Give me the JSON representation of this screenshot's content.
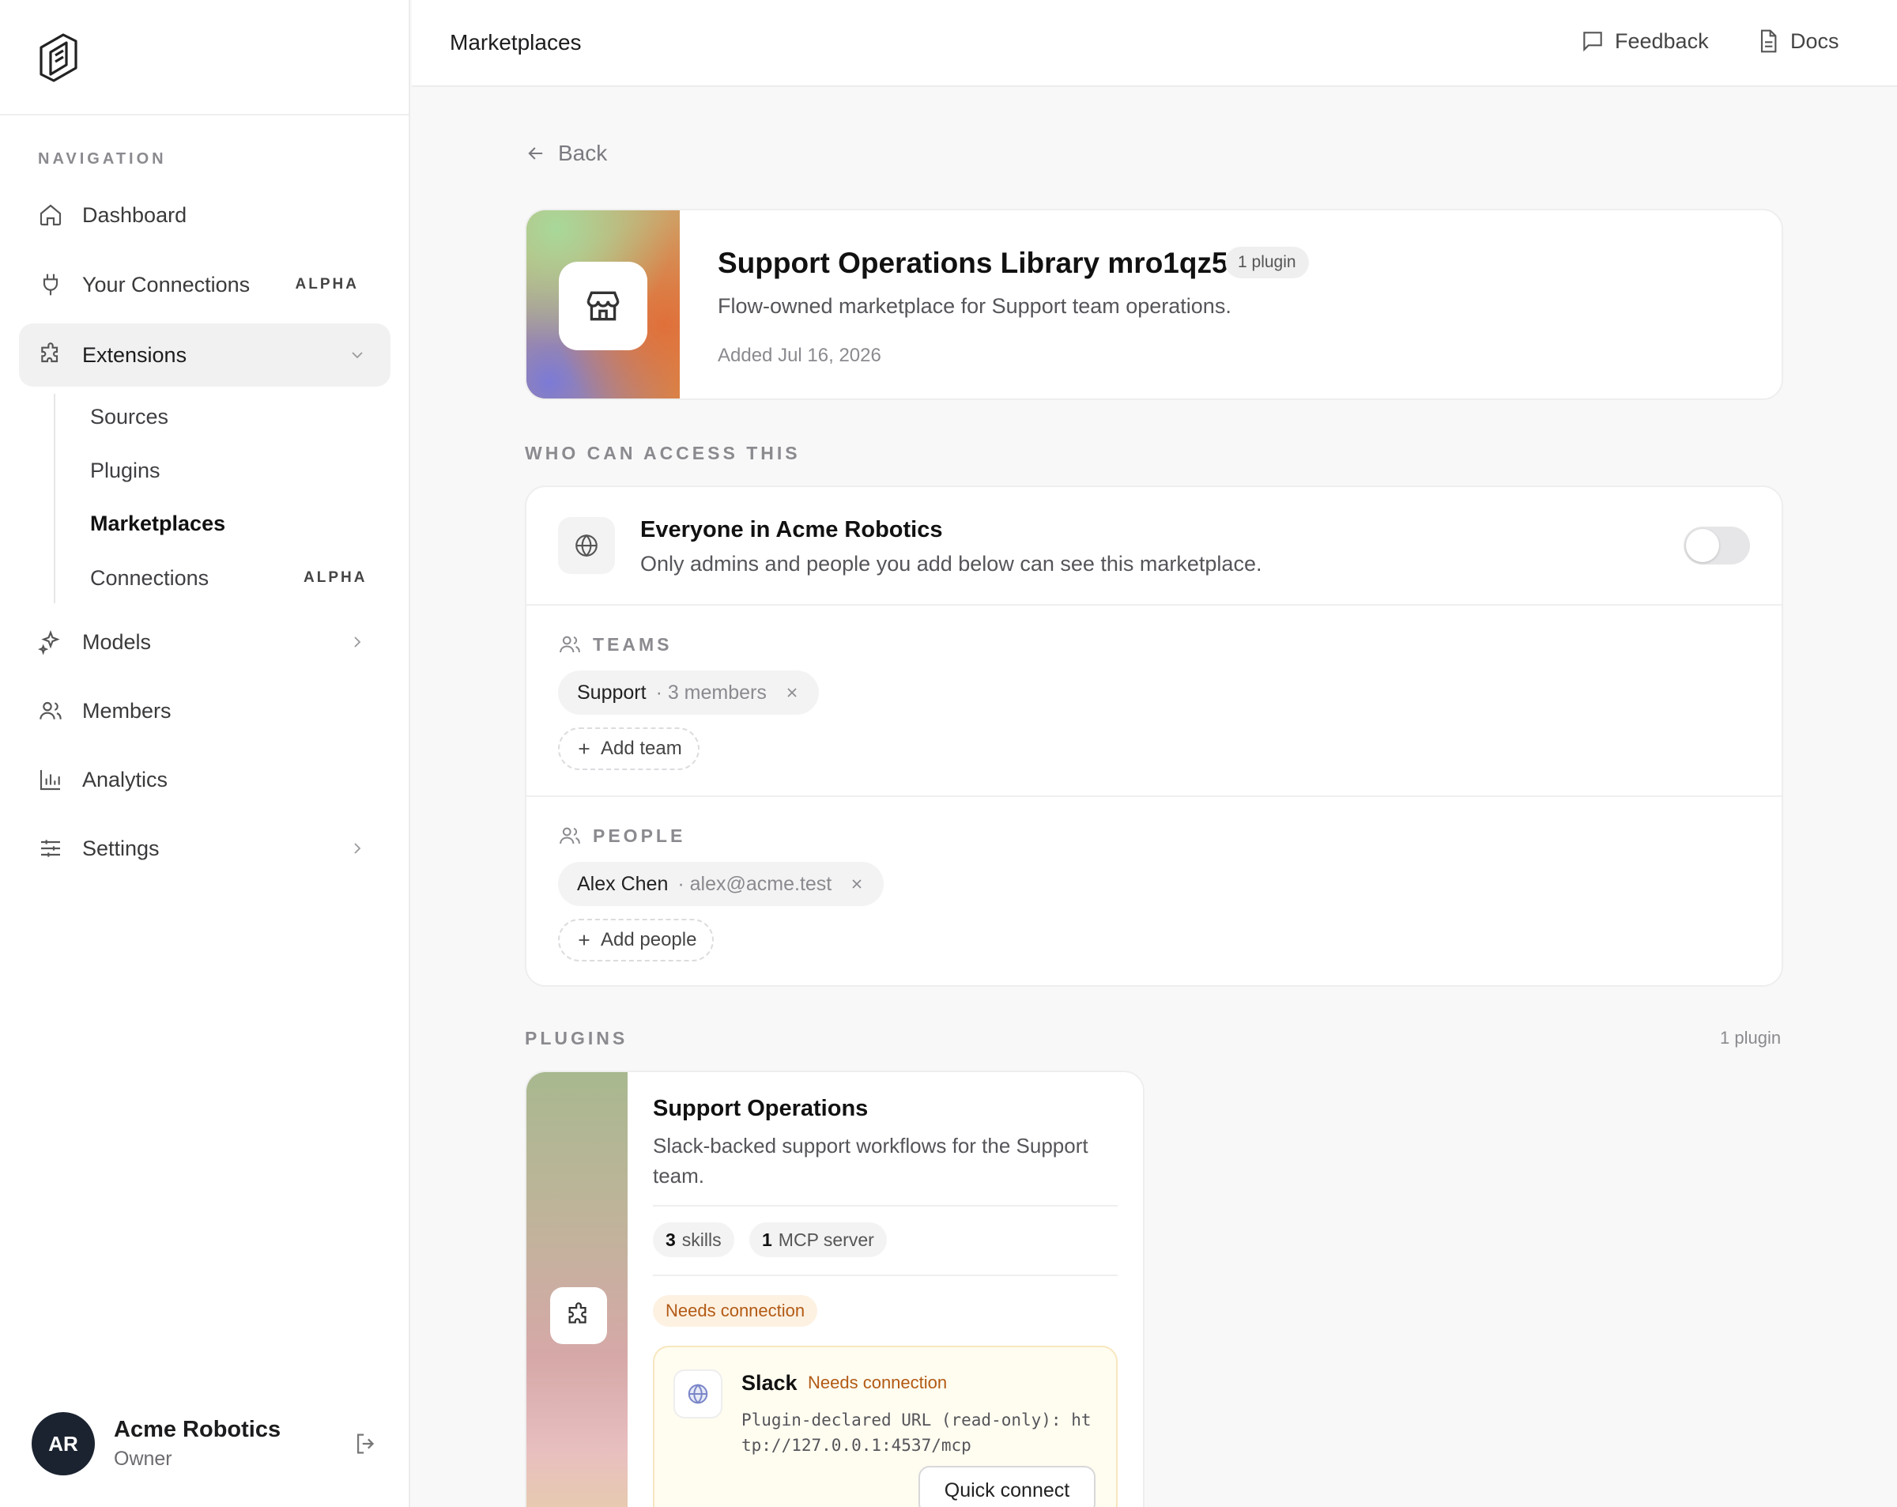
{
  "sidebar": {
    "heading": "NAVIGATION",
    "items": {
      "dashboard": "Dashboard",
      "connections": "Your Connections",
      "connections_tag": "ALPHA",
      "extensions": "Extensions",
      "models": "Models",
      "members": "Members",
      "analytics": "Analytics",
      "settings": "Settings"
    },
    "sub": {
      "sources": "Sources",
      "plugins": "Plugins",
      "marketplaces": "Marketplaces",
      "connections": "Connections",
      "connections_tag": "ALPHA"
    },
    "user": {
      "initials": "AR",
      "name": "Acme Robotics",
      "role": "Owner"
    }
  },
  "topbar": {
    "title": "Marketplaces",
    "feedback": "Feedback",
    "docs": "Docs"
  },
  "back": "Back",
  "marketplace": {
    "title": "Support Operations Library mro1qz53",
    "plugin_count": "1 plugin",
    "description": "Flow-owned marketplace for Support team operations.",
    "added": "Added Jul 16, 2026"
  },
  "access": {
    "section": "WHO CAN ACCESS THIS",
    "everyone_title": "Everyone in Acme Robotics",
    "everyone_sub": "Only admins and people you add below can see this marketplace.",
    "everyone_enabled": false,
    "teams_label": "TEAMS",
    "team_chip": {
      "name": "Support",
      "meta": "· 3 members"
    },
    "add_team": "Add team",
    "people_label": "PEOPLE",
    "person_chip": {
      "name": "Alex Chen",
      "meta": "· alex@acme.test"
    },
    "add_people": "Add people"
  },
  "plugins": {
    "section": "PLUGINS",
    "count": "1 plugin",
    "card": {
      "title": "Support Operations",
      "description": "Slack-backed support workflows for the Support team.",
      "skills_num": "3",
      "skills_label": "skills",
      "mcp_num": "1",
      "mcp_label": "MCP server",
      "status": "Needs connection",
      "connection": {
        "name": "Slack",
        "status": "Needs connection",
        "url": "Plugin-declared URL (read-only): http://127.0.0.1:4537/mcp",
        "button": "Quick connect"
      }
    }
  },
  "colors": {
    "accent_warning": "#b25a14",
    "avatar_bg": "#1b2330"
  }
}
